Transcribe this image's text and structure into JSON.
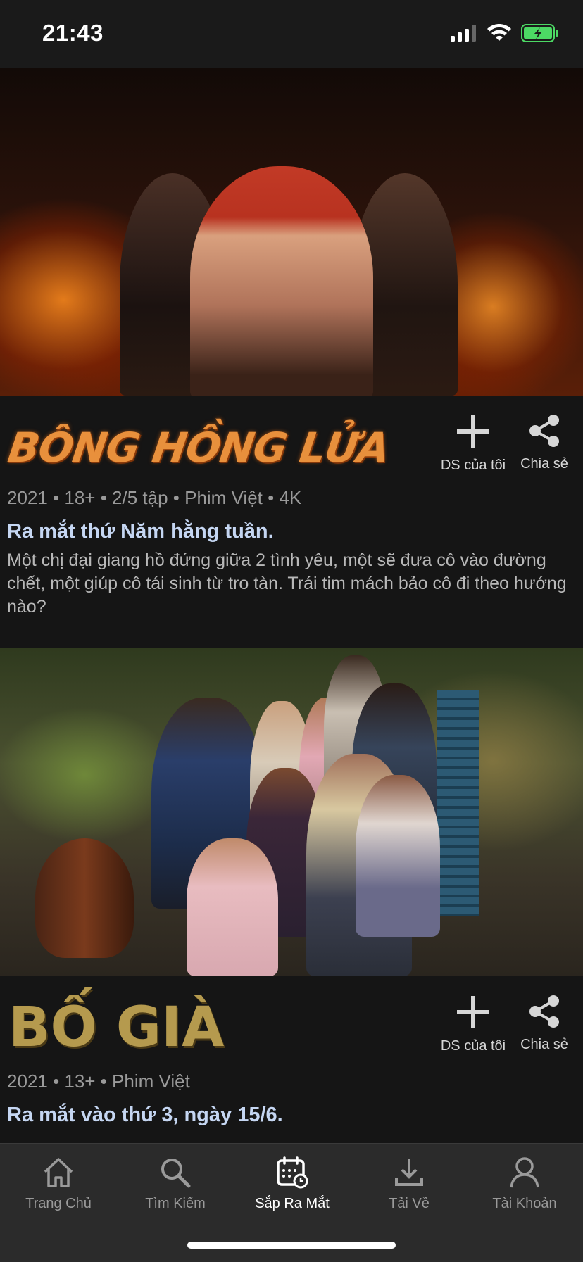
{
  "status": {
    "time": "21:43"
  },
  "cards": [
    {
      "logo": "BÔNG HỒNG LỬA",
      "actions": {
        "mylist": "DS của tôi",
        "share": "Chia sẻ"
      },
      "meta": "2021 • 18+ • 2/5 tập • Phim Việt • 4K",
      "tagline": "Ra mắt thứ Năm hằng tuần.",
      "description": "Một chị đại giang hồ đứng giữa 2 tình yêu, một sẽ đưa cô vào đường chết, một giúp cô tái sinh từ tro tàn. Trái tim mách bảo cô đi theo hướng nào?"
    },
    {
      "logo": "BỐ GIÀ",
      "actions": {
        "mylist": "DS của tôi",
        "share": "Chia sẻ"
      },
      "meta": "2021 • 13+ • Phim Việt",
      "tagline": "Ra mắt vào thứ 3, ngày 15/6."
    }
  ],
  "tabs": [
    {
      "label": "Trang Chủ",
      "icon": "home-icon"
    },
    {
      "label": "Tìm Kiếm",
      "icon": "search-icon"
    },
    {
      "label": "Sắp Ra Mắt",
      "icon": "calendar-icon",
      "active": true
    },
    {
      "label": "Tải Về",
      "icon": "download-icon"
    },
    {
      "label": "Tài Khoản",
      "icon": "account-icon"
    }
  ],
  "colors": {
    "background": "#151515",
    "tabbar": "#2b2b2b",
    "tagline": "#c5d6f2",
    "active_tab": "#ffffff",
    "inactive_tab": "#9a9a9a"
  }
}
